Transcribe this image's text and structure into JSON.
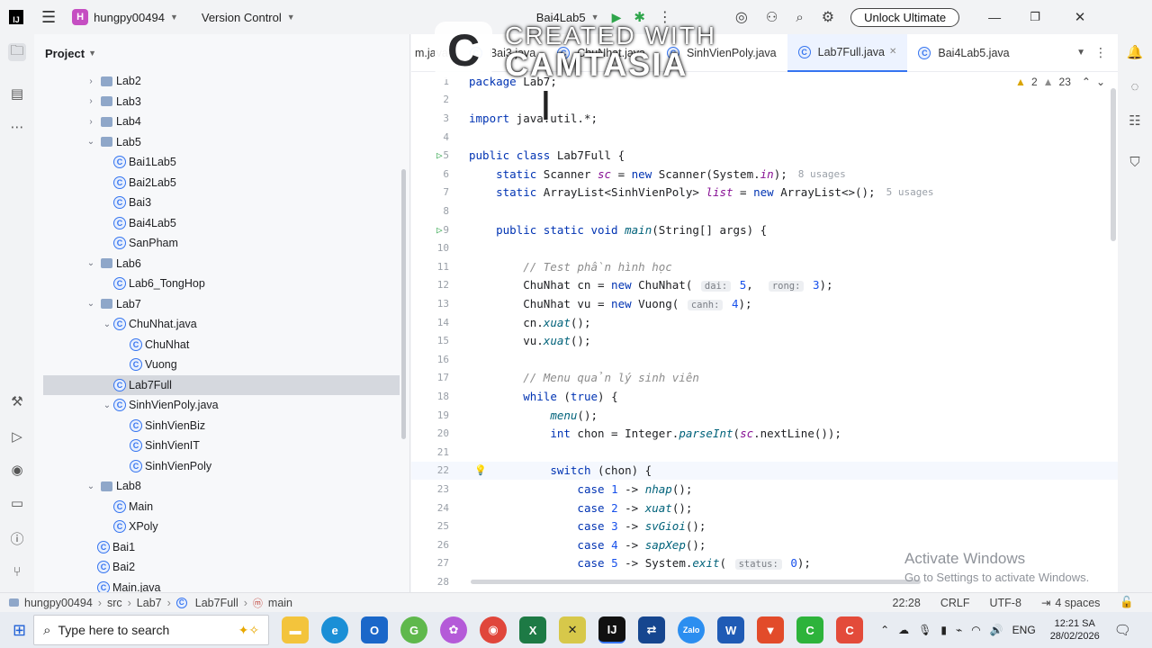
{
  "titlebar": {
    "project_badge": "H",
    "project": "hungpy00494",
    "vcs": "Version Control",
    "run_config": "Bai4Lab5",
    "unlock": "Unlock Ultimate"
  },
  "project_panel": {
    "title": "Project",
    "tree": [
      {
        "label": "Lab2",
        "type": "folder",
        "level": 1,
        "expanded": false
      },
      {
        "label": "Lab3",
        "type": "folder",
        "level": 1,
        "expanded": false
      },
      {
        "label": "Lab4",
        "type": "folder",
        "level": 1,
        "expanded": false
      },
      {
        "label": "Lab5",
        "type": "folder",
        "level": 1,
        "expanded": true
      },
      {
        "label": "Bai1Lab5",
        "type": "class",
        "level": 2
      },
      {
        "label": "Bai2Lab5",
        "type": "class",
        "level": 2
      },
      {
        "label": "Bai3",
        "type": "class",
        "level": 2
      },
      {
        "label": "Bai4Lab5",
        "type": "class",
        "level": 2
      },
      {
        "label": "SanPham",
        "type": "class",
        "level": 2
      },
      {
        "label": "Lab6",
        "type": "folder",
        "level": 1,
        "expanded": true
      },
      {
        "label": "Lab6_TongHop",
        "type": "class",
        "level": 2
      },
      {
        "label": "Lab7",
        "type": "folder",
        "level": 1,
        "expanded": true
      },
      {
        "label": "ChuNhat.java",
        "type": "file",
        "level": 2,
        "expanded": true
      },
      {
        "label": "ChuNhat",
        "type": "class",
        "level": 3
      },
      {
        "label": "Vuong",
        "type": "class",
        "level": 3
      },
      {
        "label": "Lab7Full",
        "type": "class",
        "level": 2,
        "selected": true
      },
      {
        "label": "SinhVienPoly.java",
        "type": "file",
        "level": 2,
        "expanded": true
      },
      {
        "label": "SinhVienBiz",
        "type": "class",
        "level": 3
      },
      {
        "label": "SinhVienIT",
        "type": "class",
        "level": 3
      },
      {
        "label": "SinhVienPoly",
        "type": "class",
        "level": 3
      },
      {
        "label": "Lab8",
        "type": "folder",
        "level": 1,
        "expanded": true
      },
      {
        "label": "Main",
        "type": "class",
        "level": 2
      },
      {
        "label": "XPoly",
        "type": "class",
        "level": 2
      },
      {
        "label": "Bai1",
        "type": "class",
        "level": 1
      },
      {
        "label": "Bai2",
        "type": "class",
        "level": 1
      },
      {
        "label": "Main.java",
        "type": "class",
        "level": 1
      }
    ]
  },
  "tabs": [
    {
      "label": "m.java"
    },
    {
      "label": "Bai3.java"
    },
    {
      "label": "ChuNhat.java"
    },
    {
      "label": "SinhVienPoly.java"
    },
    {
      "label": "Lab7Full.java",
      "active": true
    },
    {
      "label": "Bai4Lab5.java"
    }
  ],
  "inspections": {
    "warnings": "2",
    "weak": "23"
  },
  "code": [
    {
      "n": "1",
      "t": "package Lab7;"
    },
    {
      "n": "2",
      "t": ""
    },
    {
      "n": "3",
      "t": "import java.util.*;"
    },
    {
      "n": "4",
      "t": ""
    },
    {
      "n": "5",
      "t": "public class Lab7Full {"
    },
    {
      "n": "6",
      "t": "    static Scanner sc = new Scanner(System.in);",
      "u": "8 usages"
    },
    {
      "n": "7",
      "t": "    static ArrayList<SinhVienPoly> list = new ArrayList<>();",
      "u": "5 usages"
    },
    {
      "n": "8",
      "t": ""
    },
    {
      "n": "9",
      "t": "    public static void main(String[] args) {"
    },
    {
      "n": "10",
      "t": ""
    },
    {
      "n": "11",
      "t": "        // Test phần hình học"
    },
    {
      "n": "12",
      "t": "        ChuNhat cn = new ChuNhat( dai: 5,  rong: 3);"
    },
    {
      "n": "13",
      "t": "        ChuNhat vu = new Vuong( canh: 4);"
    },
    {
      "n": "14",
      "t": "        cn.xuat();"
    },
    {
      "n": "15",
      "t": "        vu.xuat();"
    },
    {
      "n": "16",
      "t": ""
    },
    {
      "n": "17",
      "t": "        // Menu quản lý sinh viên"
    },
    {
      "n": "18",
      "t": "        while (true) {"
    },
    {
      "n": "19",
      "t": "            menu();"
    },
    {
      "n": "20",
      "t": "            int chon = Integer.parseInt(sc.nextLine());"
    },
    {
      "n": "21",
      "t": ""
    },
    {
      "n": "22",
      "t": "            switch (chon) {"
    },
    {
      "n": "23",
      "t": "                case 1 -> nhap();"
    },
    {
      "n": "24",
      "t": "                case 2 -> xuat();"
    },
    {
      "n": "25",
      "t": "                case 3 -> svGioi();"
    },
    {
      "n": "26",
      "t": "                case 4 -> sapXep();"
    },
    {
      "n": "27",
      "t": "                case 5 -> System.exit( status: 0);"
    },
    {
      "n": "28",
      "t": ""
    }
  ],
  "status": {
    "crumbs": [
      "hungpy00494",
      "src",
      "Lab7",
      "Lab7Full",
      "main"
    ],
    "pos": "22:28",
    "eol": "CRLF",
    "enc": "UTF-8",
    "indent": "4 spaces"
  },
  "watermark": {
    "line1": "CREATED WITH",
    "line2": "CAMTASIA"
  },
  "activate": {
    "title": "Activate Windows",
    "sub": "Go to Settings to activate Windows."
  },
  "taskbar": {
    "search": "Type here to search",
    "lang": "ENG",
    "time": "12:21 SA",
    "date": "28/02/2026"
  }
}
